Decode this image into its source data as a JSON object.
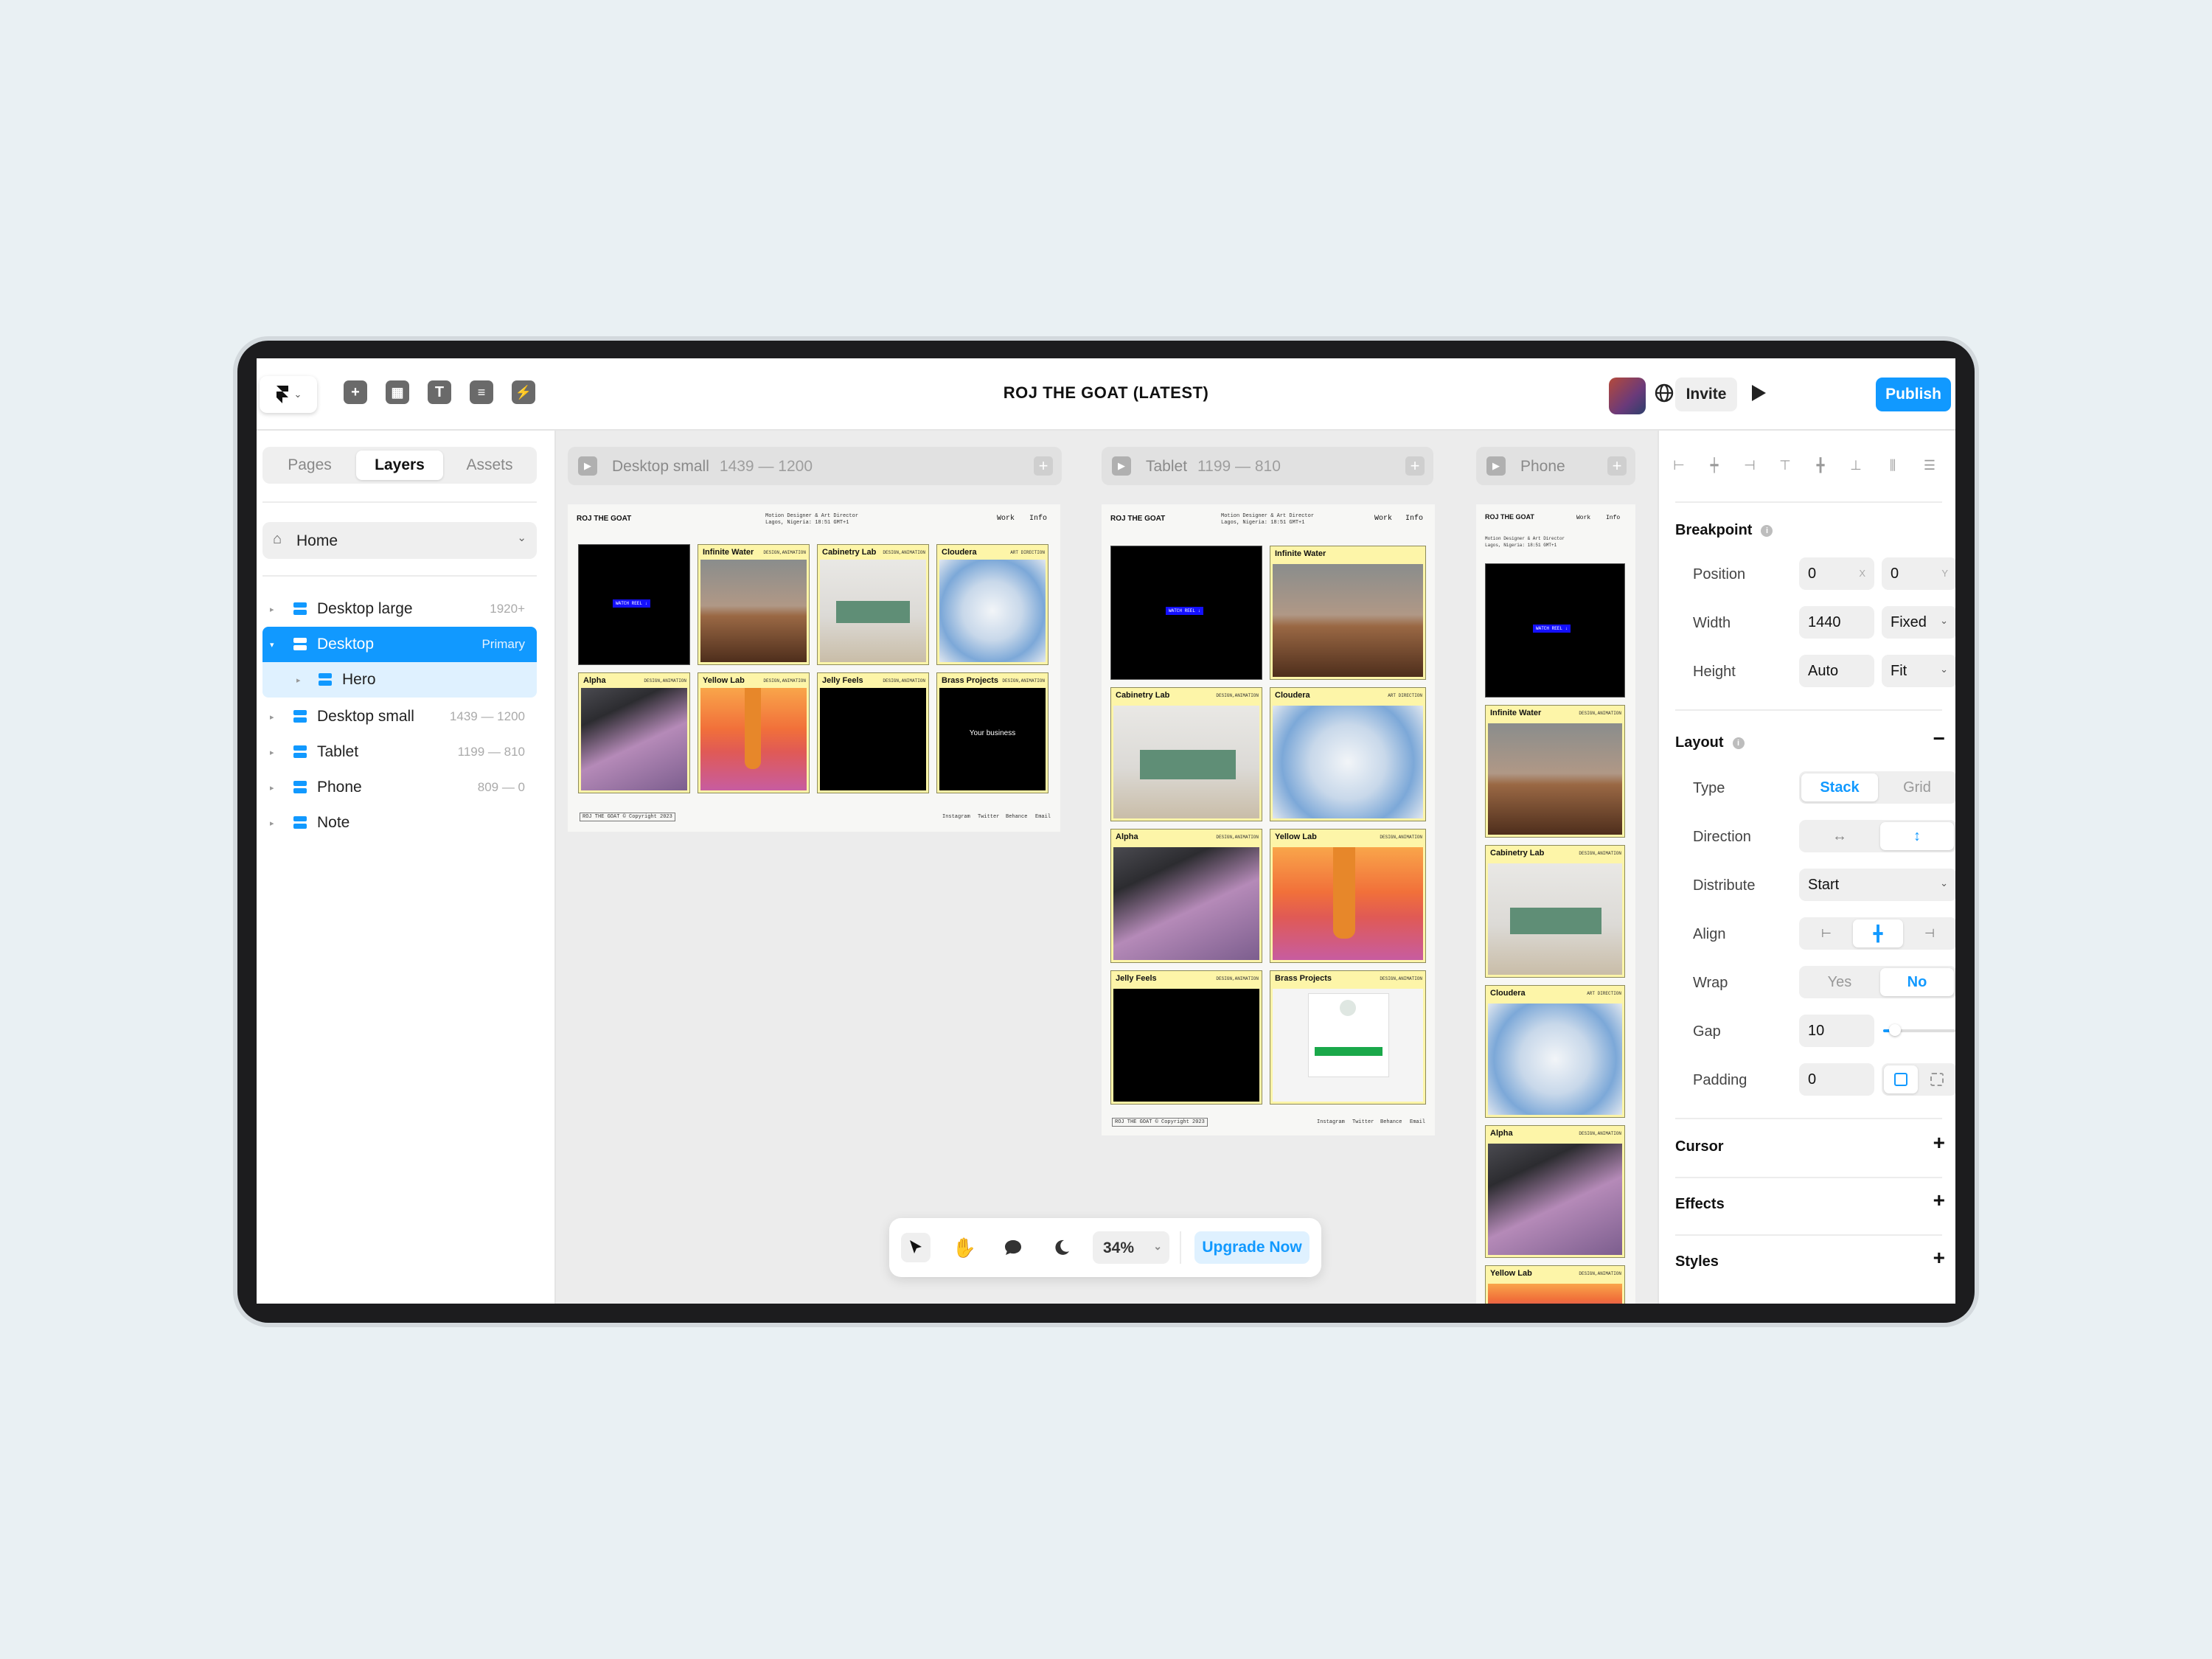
{
  "app": {
    "title": "ROJ THE GOAT (LATEST)",
    "invite_label": "Invite",
    "publish_label": "Publish",
    "accent": "#1199ff"
  },
  "toolbar_icons": [
    "framer-logo-icon",
    "insert-icon",
    "layout-icon",
    "text-icon",
    "cms-icon",
    "interactions-icon"
  ],
  "left_panel": {
    "tabs": [
      "Pages",
      "Layers",
      "Assets"
    ],
    "active_tab": "Layers",
    "page_select": "Home",
    "layers": [
      {
        "name": "Desktop large",
        "range": "1920+"
      },
      {
        "name": "Desktop",
        "range": "Primary"
      },
      {
        "name": "Hero",
        "range": ""
      },
      {
        "name": "Desktop small",
        "range": "1439 — 1200"
      },
      {
        "name": "Tablet",
        "range": "1199 — 810"
      },
      {
        "name": "Phone",
        "range": "809 — 0"
      },
      {
        "name": "Note",
        "range": ""
      }
    ]
  },
  "canvas": {
    "breakpoints": [
      {
        "name": "Desktop small",
        "range": "1439 — 1200"
      },
      {
        "name": "Tablet",
        "range": "1199 — 810"
      },
      {
        "name": "Phone",
        "range": ""
      }
    ],
    "site": {
      "brand": "ROJ THE GOAT",
      "tagline_1": "Motion Designer & Art Director",
      "tagline_2": "Lagos, Nigeria: 18:51 GMT+1",
      "nav_work": "Work",
      "nav_info": "Info",
      "watch_reel": "WATCH REEL ↓",
      "your_business": "Your business",
      "copyright": "ROJ THE GOAT © Copyright 2023",
      "social": [
        "Instagram",
        "Twitter",
        "Behance",
        "Email"
      ],
      "projects": [
        {
          "title": "Infinite Water",
          "tag": "DESIGN,ANIMATION"
        },
        {
          "title": "Cabinetry Lab",
          "tag": "DESIGN,ANIMATION"
        },
        {
          "title": "Cloudera",
          "tag": "ART DIRECTION"
        },
        {
          "title": "Alpha",
          "tag": "DESIGN,ANIMATION"
        },
        {
          "title": "Yellow Lab",
          "tag": "DESIGN,ANIMATION"
        },
        {
          "title": "Jelly Feels",
          "tag": "DESIGN,ANIMATION"
        },
        {
          "title": "Brass Projects",
          "tag": "DESIGN,ANIMATION"
        }
      ]
    }
  },
  "floating_bar": {
    "zoom": "34%",
    "upgrade_label": "Upgrade Now"
  },
  "right_panel": {
    "breakpoint": {
      "title": "Breakpoint",
      "position_label": "Position",
      "position_x": "0",
      "position_y": "0",
      "axis_x": "X",
      "axis_y": "Y",
      "width_label": "Width",
      "width_value": "1440",
      "width_mode": "Fixed",
      "height_label": "Height",
      "height_value": "Auto",
      "height_mode": "Fit"
    },
    "layout": {
      "title": "Layout",
      "type_label": "Type",
      "type_options": [
        "Stack",
        "Grid"
      ],
      "type_selected": "Stack",
      "direction_label": "Direction",
      "distribute_label": "Distribute",
      "distribute_value": "Start",
      "align_label": "Align",
      "wrap_label": "Wrap",
      "wrap_options": [
        "Yes",
        "No"
      ],
      "wrap_selected": "No",
      "gap_label": "Gap",
      "gap_value": "10",
      "padding_label": "Padding",
      "padding_value": "0"
    },
    "sections": [
      "Cursor",
      "Effects",
      "Styles"
    ]
  }
}
